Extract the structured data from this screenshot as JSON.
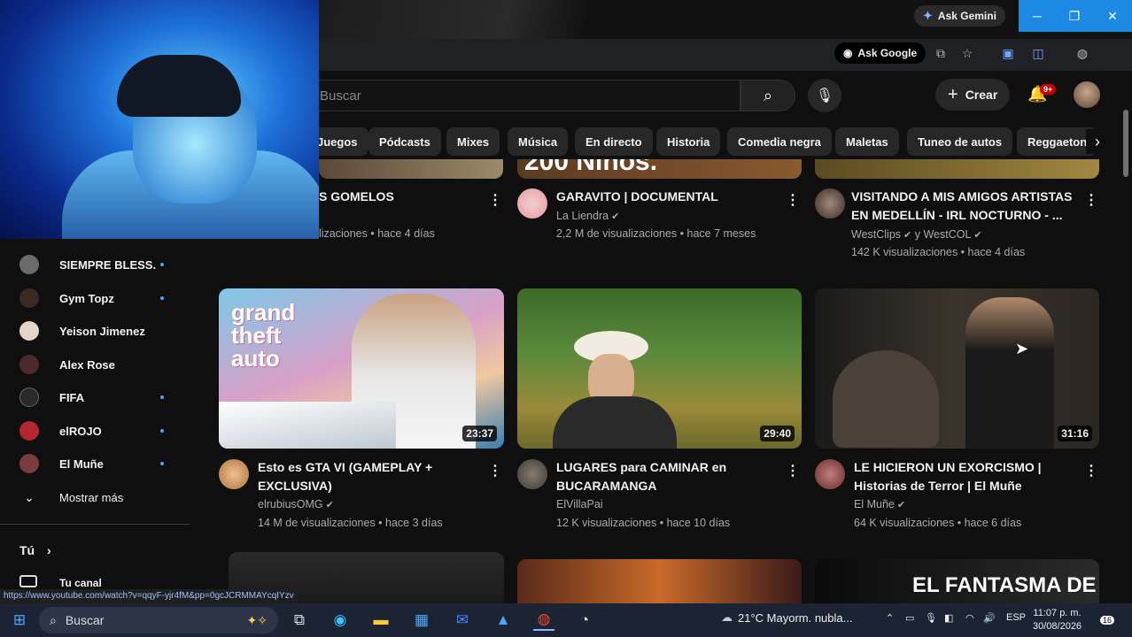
{
  "browser": {
    "gemini_label": "Ask Gemini",
    "ask_google_label": "Ask Google"
  },
  "youtube": {
    "search_placeholder": "Buscar",
    "create_label": "Crear",
    "notifications_badge": "9+",
    "chips": [
      "Juegos",
      "Pódcasts",
      "Mixes",
      "Música",
      "En directo",
      "Historia",
      "Comedia negra",
      "Maletas",
      "Tuneo de autos",
      "Reggaeton"
    ]
  },
  "sidebar": {
    "subscriptions": [
      {
        "label": "SIEMPRE BLESS...",
        "dot": true,
        "color": "#6b6b6b"
      },
      {
        "label": "Gym Topz",
        "dot": true,
        "color": "#3a2a22"
      },
      {
        "label": "Yeison Jimenez",
        "dot": false,
        "color": "#e3d6c8"
      },
      {
        "label": "Alex Rose",
        "dot": false,
        "color": "#4a2a2a"
      },
      {
        "label": "FIFA",
        "dot": true,
        "color": "#2a2a2a"
      },
      {
        "label": "elROJO",
        "dot": true,
        "color": "#b3262e"
      },
      {
        "label": "El Muñe",
        "dot": true,
        "color": "#7a3c3c"
      }
    ],
    "show_more": "Mostrar más",
    "you_section": "Tú",
    "your_channel": "Tu canal"
  },
  "videos_row1": [
    {
      "title": "S GOMELOS",
      "channel": "",
      "meta": "lizaciones • hace 4 días"
    },
    {
      "title": "GARAVITO | DOCUMENTAL",
      "channel": "La Liendra",
      "meta": "2,2 M de visualizaciones • hace 7 meses"
    },
    {
      "title": "VISITANDO A MIS AMIGOS ARTISTAS EN MEDELLÍN - IRL NOCTURNO - ...",
      "channel": "WestClips",
      "channel2": "y WestCOL",
      "meta": "142 K visualizaciones • hace 4 días"
    }
  ],
  "row1_thumb_text": "200 Niños.",
  "videos_row2": [
    {
      "title": "Esto es GTA VI (GAMEPLAY + EXCLUSIVA)",
      "channel": "elrubiusOMG",
      "meta": "14 M de visualizaciones • hace 3 días",
      "duration": "23:37"
    },
    {
      "title": "LUGARES para CAMINAR en BUCARAMANGA",
      "channel": "ElVillaPai",
      "meta": "12 K visualizaciones • hace 10 días",
      "duration": "29:40"
    },
    {
      "title": "LE HICIERON UN EXORCISMO | Historias de Terror | El Muñe",
      "channel": "El Muñe",
      "meta": "64 K visualizaciones • hace 6 días",
      "duration": "31:16"
    }
  ],
  "gta_logo": "grand theft auto",
  "row3_thumb_text": "EL FANTASMA DE",
  "status_url": "https://www.youtube.com/watch?v=qqyF-yjr4fM&pp=0gcJCRMMAYcqIYzv",
  "taskbar": {
    "search_label": "Buscar",
    "weather": "21°C  Mayorm. nubla...",
    "language": "ESP",
    "time": "11:07 p. m.",
    "date": "30/08/2026",
    "notif_count": "16"
  }
}
